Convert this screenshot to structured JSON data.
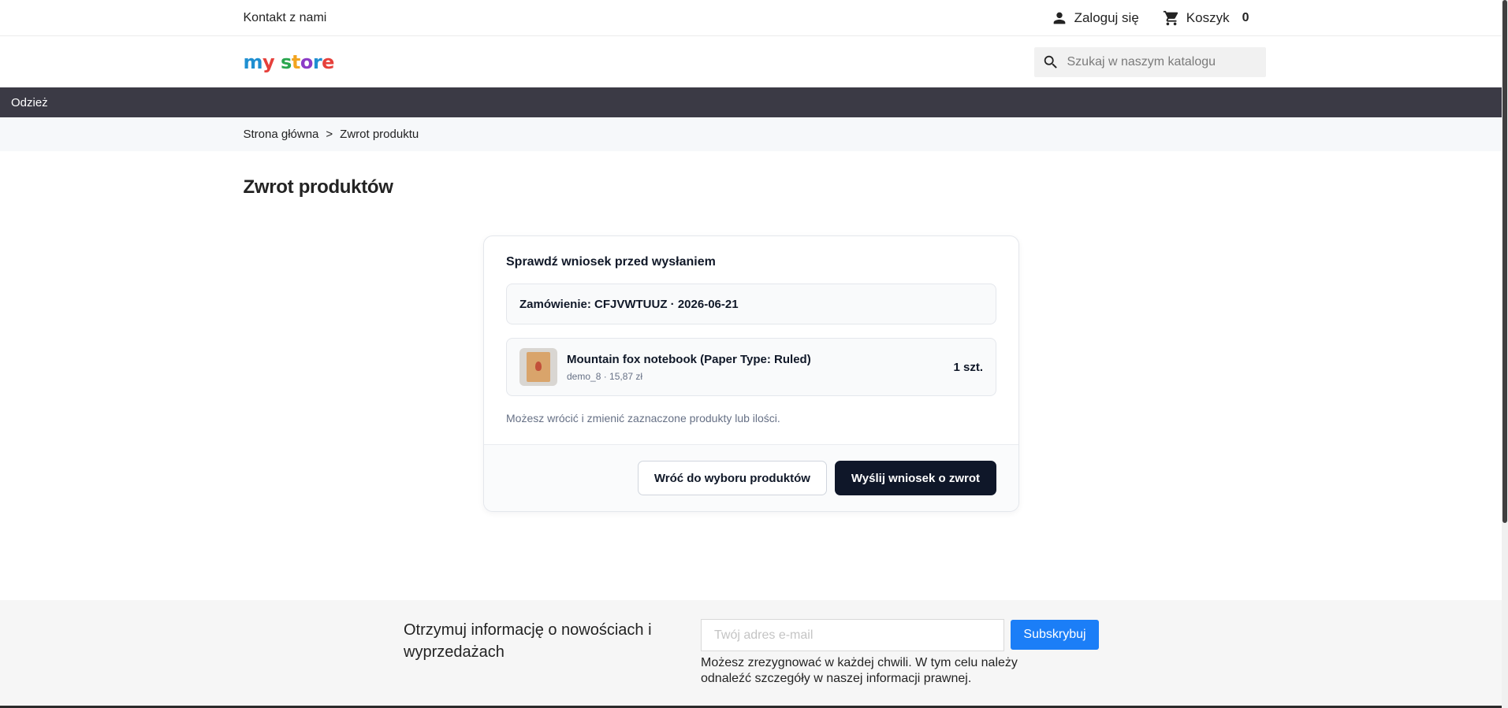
{
  "topbar": {
    "contact": "Kontakt z nami",
    "login": "Zaloguj się",
    "cart_label": "Koszyk",
    "cart_count": "0"
  },
  "header": {
    "logo_text": "my store",
    "search_placeholder": "Szukaj w naszym katalogu"
  },
  "nav": {
    "items": [
      {
        "label": "Odzież"
      }
    ]
  },
  "breadcrumb": {
    "home": "Strona główna",
    "separator": ">",
    "current": "Zwrot produktu"
  },
  "page": {
    "title": "Zwrot produktów",
    "card": {
      "title": "Sprawdź wniosek przed wysłaniem",
      "order_line": "Zamówienie: CFJVWTUUZ · 2026-06-21",
      "item": {
        "name": "Mountain fox notebook (Paper Type: Ruled)",
        "meta": "demo_8 · 15,87 zł",
        "qty": "1 szt."
      },
      "hint": "Możesz wrócić i zmienić zaznaczone produkty lub ilości.",
      "back_button": "Wróć do wyboru produktów",
      "submit_button": "Wyślij wniosek o zwrot"
    }
  },
  "newsletter": {
    "text": "Otrzymuj informację o nowościach i wyprzedażach",
    "email_placeholder": "Twój adres e-mail",
    "subscribe_button": "Subskrybuj",
    "note": "Możesz zrezygnować w każdej chwili. W tym celu należy odnaleźć szczegóły w naszej informacji prawnej."
  },
  "colors": {
    "nav_bg": "#3b3a45",
    "primary_button": "#0f1729",
    "subscribe_button": "#1b7ef7"
  },
  "icons": {
    "login": "user-icon",
    "cart": "cart-icon",
    "search": "search-icon"
  }
}
